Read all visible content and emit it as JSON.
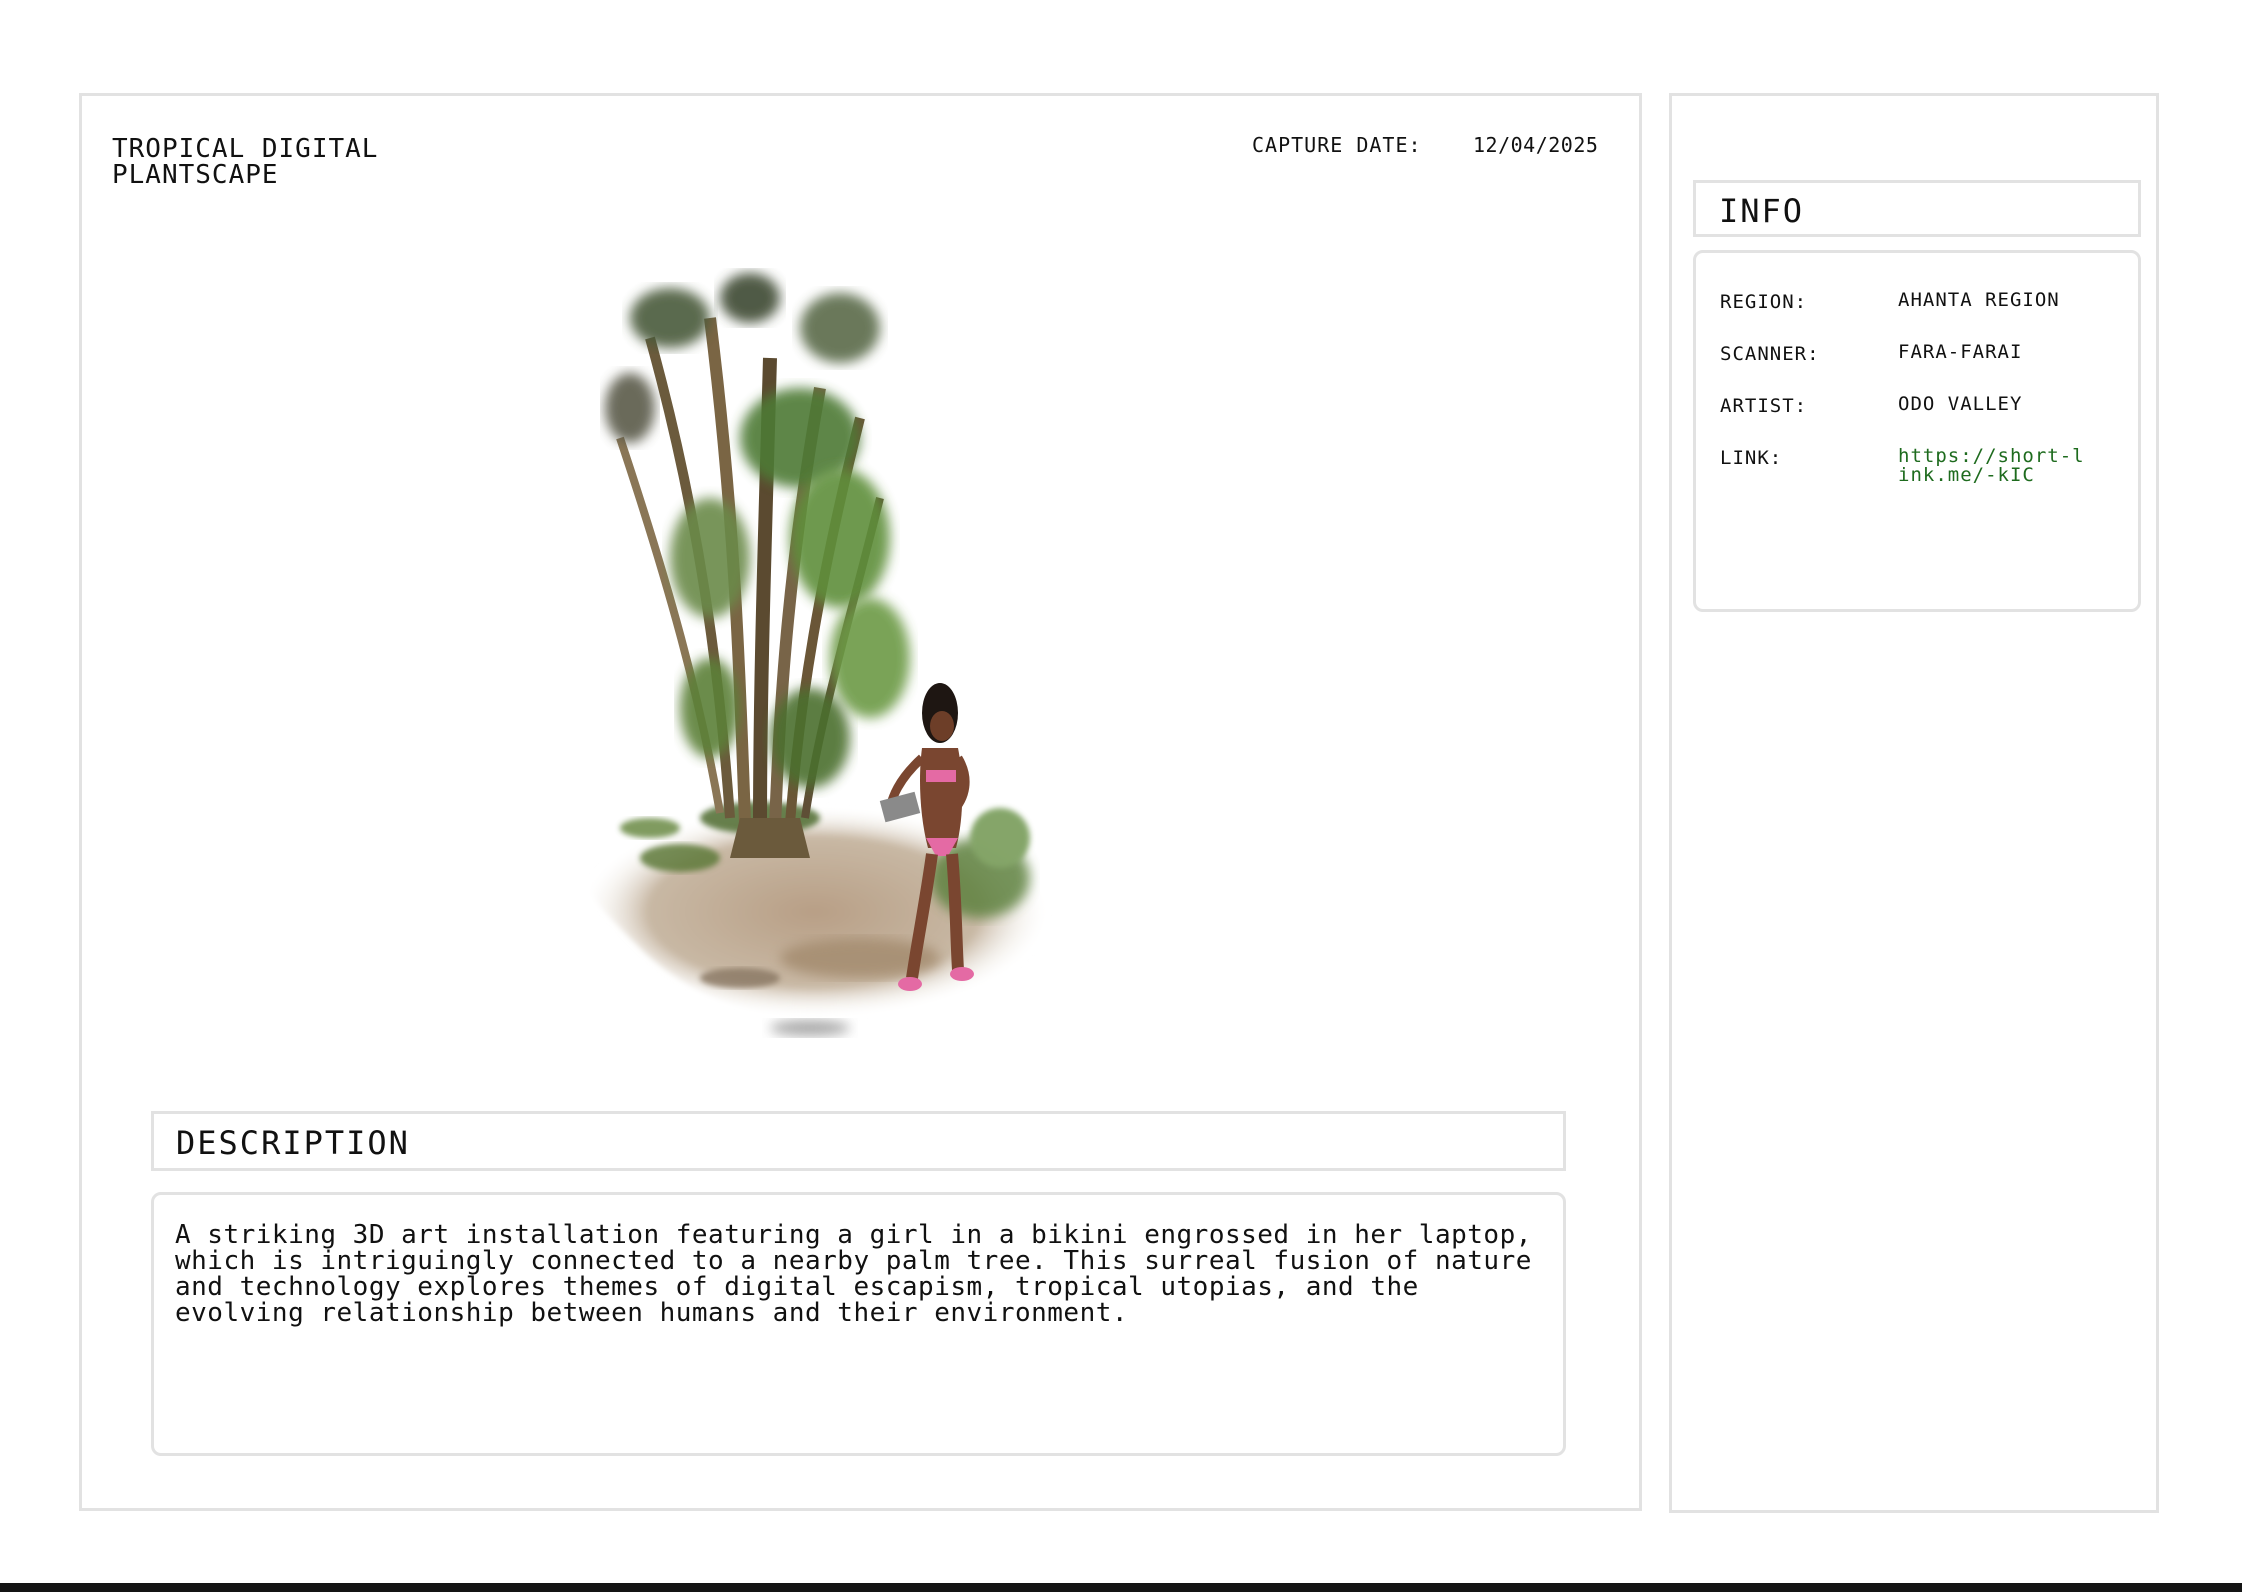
{
  "card": {
    "title": "TROPICAL DIGITAL\nPLANTSCAPE",
    "capture_date_label": "CAPTURE DATE:",
    "capture_date_value": "12/04/2025"
  },
  "artwork": {
    "icon": "palm-tree-with-figure-3d-scan"
  },
  "description": {
    "header": "DESCRIPTION",
    "text": "A striking 3D art installation featuring a girl in a bikini engrossed in her laptop, which is intriguingly connected to a nearby palm tree. This surreal fusion of nature and technology explores themes of digital escapism, tropical utopias, and the evolving relationship between humans and their environment."
  },
  "info": {
    "header": "INFO",
    "rows": [
      {
        "label": "REGION:",
        "value": "AHANTA REGION"
      },
      {
        "label": "SCANNER:",
        "value": "FARA-FARAI"
      },
      {
        "label": "ARTIST:",
        "value": "ODO VALLEY"
      },
      {
        "label": "LINK:",
        "value": "https://short-link.me/-kIC"
      }
    ]
  },
  "colors": {
    "border": "#e2e2e2",
    "link": "#1e6b1e",
    "text": "#111111",
    "bottom_bar": "#141414"
  }
}
